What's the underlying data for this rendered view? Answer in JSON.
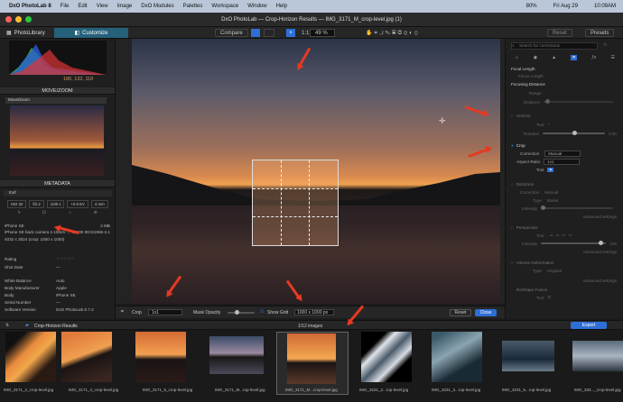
{
  "menubar": {
    "app": "DxO PhotoLab 8",
    "items": [
      "File",
      "Edit",
      "View",
      "Image",
      "DxO Modules",
      "Palettes",
      "Workspace",
      "Window",
      "Help"
    ],
    "status": [
      "80%",
      "Fri Aug 29",
      "10:09AM"
    ]
  },
  "window": {
    "title": "DxO PhotoLab — Crop-Horizon Results — IMG_3171_M_crop-level.jpg (1)"
  },
  "tabs": {
    "library": "PhotoLibrary",
    "customize": "Customize"
  },
  "toolbar": {
    "compare": "Compare",
    "fit": "1:1",
    "zoom": "49 %",
    "reset": "Reset",
    "presets": "Presets"
  },
  "histogram": {
    "values": "186, 132, 118"
  },
  "left": {
    "movezoom": "MOVE/ZOOM",
    "metadata": "METADATA",
    "exif": "Exif",
    "exif_row1": [
      "ISO 32",
      "f/2.2",
      "1/30 s",
      "+0.0 EV",
      "4 mm"
    ],
    "camera": "iPhone SE",
    "size": "2 MB",
    "lens": "iPhone SE back camera 4.15mm ...",
    "colorspace": "sRGB IEC61966-2.1",
    "dims": "4032 x 3024 (crop: 1000 x 1000)",
    "fields": [
      {
        "k": "Rating",
        "v": "☆☆☆☆☆"
      },
      {
        "k": "Shot Date",
        "v": "—"
      },
      {
        "k": "White Balance",
        "v": "Auto"
      },
      {
        "k": "Body Manufacturer",
        "v": "Apple"
      },
      {
        "k": "Body",
        "v": "iPhone SE"
      },
      {
        "k": "Serial Number",
        "v": "—"
      },
      {
        "k": "Software Version",
        "v": "DxO PhotoLab 8.7.2"
      }
    ]
  },
  "bottombar": {
    "crop": "Crop",
    "ratio": "1x1",
    "mask": "Mask Opacity",
    "grid": "Show Grid",
    "size": "1000 x 1000 px",
    "reset": "Reset",
    "close": "Close"
  },
  "right": {
    "search": "Search for corrections",
    "focal": "Focal Length",
    "focal_sub": "Focus Length",
    "focusing": "Focusing Distance",
    "range": "Range",
    "distance": "Distance",
    "horizon": "Horizon",
    "tool": "Tool",
    "rotation": "Rotation",
    "rotation_val": "0.00",
    "crop": "Crop",
    "correction": "Correction",
    "correction_val": "Manual",
    "aspect": "Aspect Ratio",
    "aspect_val": "1x1",
    "distortion": "Distortion",
    "distortion_correction": "Manual",
    "type": "Type",
    "type_val": "Barrel",
    "intensity": "Intensity",
    "advanced": "Advanced settings",
    "perspective": "Perspective",
    "persp_intensity": "100",
    "volume": "Volume Deformation",
    "vol_type": "Original",
    "reshape": "ReShape Fusion"
  },
  "filmstrip": {
    "project": "Crop-Horizon Results",
    "count": "1/12 images",
    "export": "Export",
    "labels": [
      "IMG_3171_2_crop-level.jpg",
      "IMG_3171_4_crop-level.jpg",
      "IMG_3171_5_crop-level.jpg",
      "IMG_3171_M...rop-level.jpg",
      "IMG_3171_M...crop-level.jpg",
      "IMG_3231_2...rop-level.jpg",
      "IMG_3231_3...rop-level.jpg",
      "IMG_3231_5...rop-level.jpg",
      "IMG_333..._crop-level.jpg"
    ]
  },
  "colors": {
    "accent": "#2e6fd6",
    "arrow": "#e53a23"
  }
}
